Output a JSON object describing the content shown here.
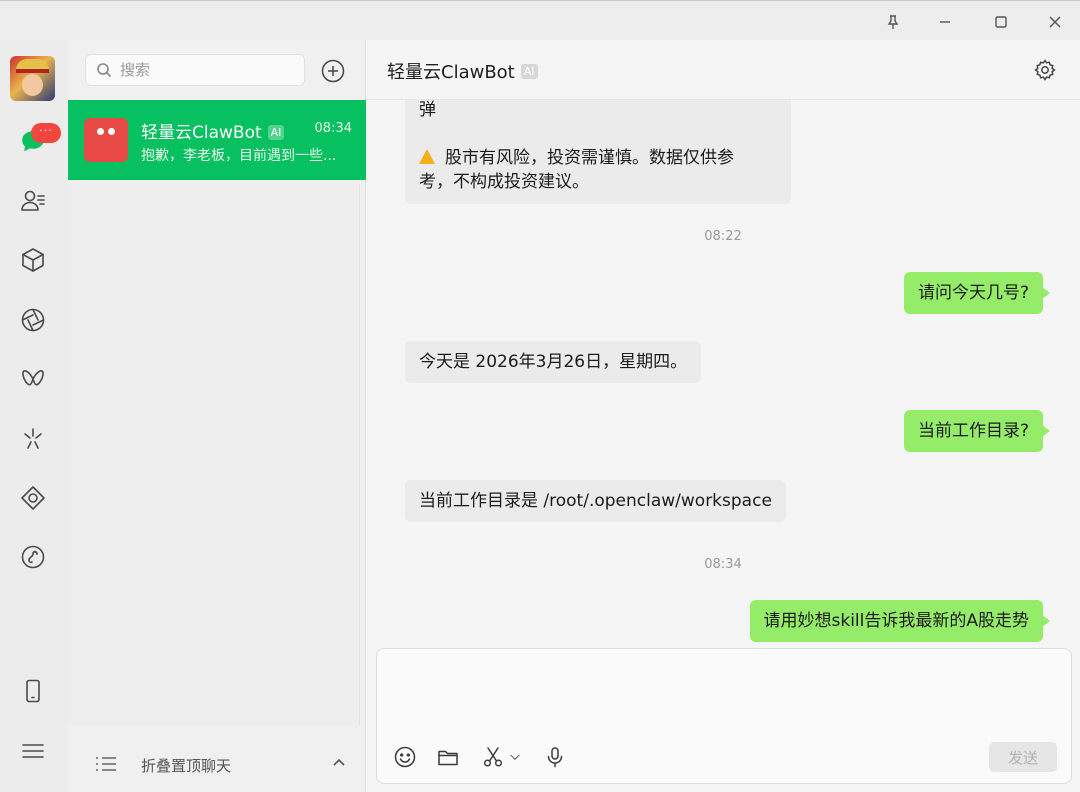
{
  "search": {
    "placeholder": "搜索"
  },
  "rail": {
    "badge": "···"
  },
  "chat_list": {
    "items": [
      {
        "name": "轻量云ClawBot",
        "tag": "AI",
        "time": "08:34",
        "preview": "抱歉，李老板，目前遇到一些..."
      }
    ],
    "footer_label": "折叠置顶聊天"
  },
  "conversation": {
    "title": "轻量云ClawBot",
    "tag": "AI",
    "messages": [
      {
        "from": "bot",
        "line1": "弹",
        "line2": "股市有风险，投资需谨慎。数据仅供参",
        "line3": "考，不构成投资建议。"
      },
      {
        "type": "time",
        "text": "08:22"
      },
      {
        "from": "me",
        "text": "请问今天几号?"
      },
      {
        "from": "bot",
        "text": "今天是 2026年3月26日，星期四。"
      },
      {
        "from": "me",
        "text": "当前工作目录?"
      },
      {
        "from": "bot",
        "text": "当前工作目录是 /root/.openclaw/workspace"
      },
      {
        "type": "time",
        "text": "08:34"
      },
      {
        "from": "me",
        "text": "请用妙想skill告诉我最新的A股走势"
      }
    ]
  },
  "composer": {
    "send_label": "发送"
  },
  "colors": {
    "accent": "#07c160",
    "outgoing_bubble": "#95ec69",
    "badge": "#f2463e",
    "bot_avatar": "#e84a45"
  }
}
